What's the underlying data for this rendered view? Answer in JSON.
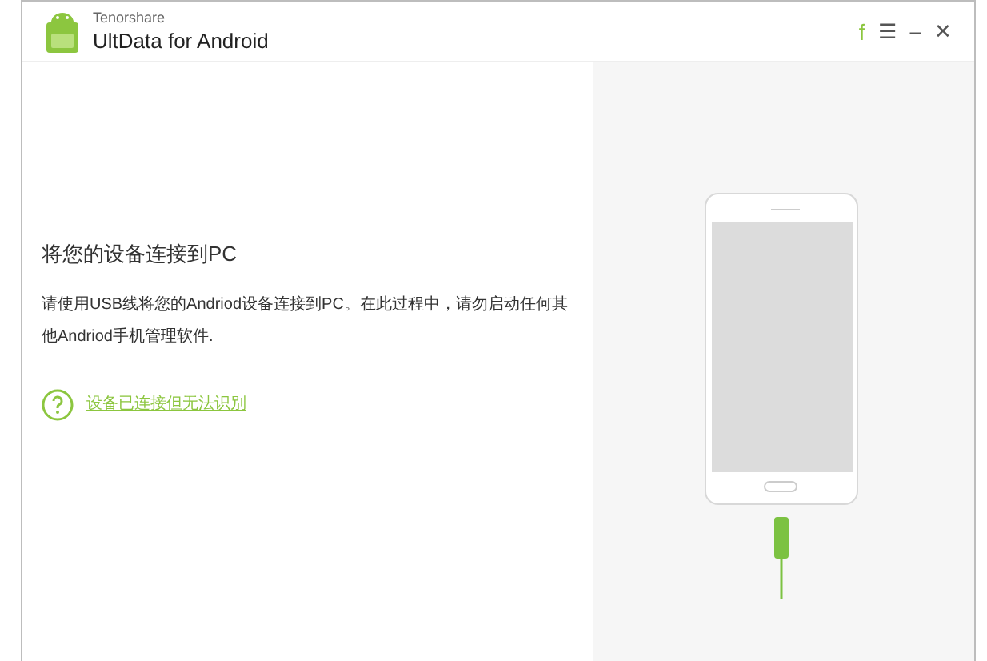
{
  "window": {
    "brand": "Tenorshare",
    "title": "UltData for Android",
    "controls": [
      "f",
      "☰",
      "–",
      "✕"
    ]
  },
  "content": {
    "heading": "将您的设备连接到PC",
    "description": "请使用USB线将您的Andriod设备连接到PC。在此过程中，请勿启动任何其他Andriod手机管理软件.",
    "help_link": "设备已连接但无法识别"
  }
}
